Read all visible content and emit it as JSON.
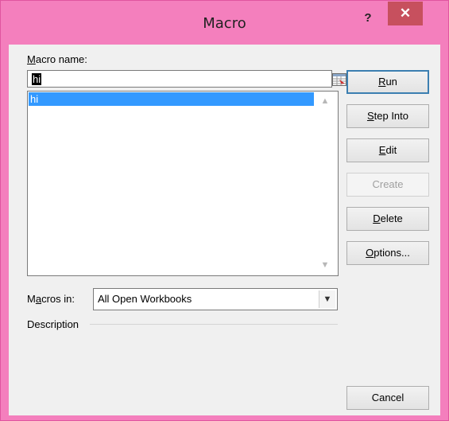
{
  "window": {
    "title": "Macro",
    "help_label": "?",
    "close_label": "✕"
  },
  "macro_name": {
    "label_prefix": "M",
    "label_rest": "acro name:",
    "value": "hi"
  },
  "macro_list": {
    "items": [
      "hi"
    ]
  },
  "buttons": {
    "run": {
      "u": "R",
      "rest": "un"
    },
    "step_into": {
      "u": "S",
      "rest": "tep Into"
    },
    "edit": {
      "u": "E",
      "rest": "dit"
    },
    "create": "Create",
    "delete": {
      "u": "D",
      "rest": "elete"
    },
    "options": {
      "u": "O",
      "rest": "ptions..."
    },
    "cancel": "Cancel"
  },
  "macros_in": {
    "label_pre": "M",
    "label_u": "a",
    "label_post": "cros in:",
    "value": "All Open Workbooks"
  },
  "description": {
    "label": "Description"
  }
}
